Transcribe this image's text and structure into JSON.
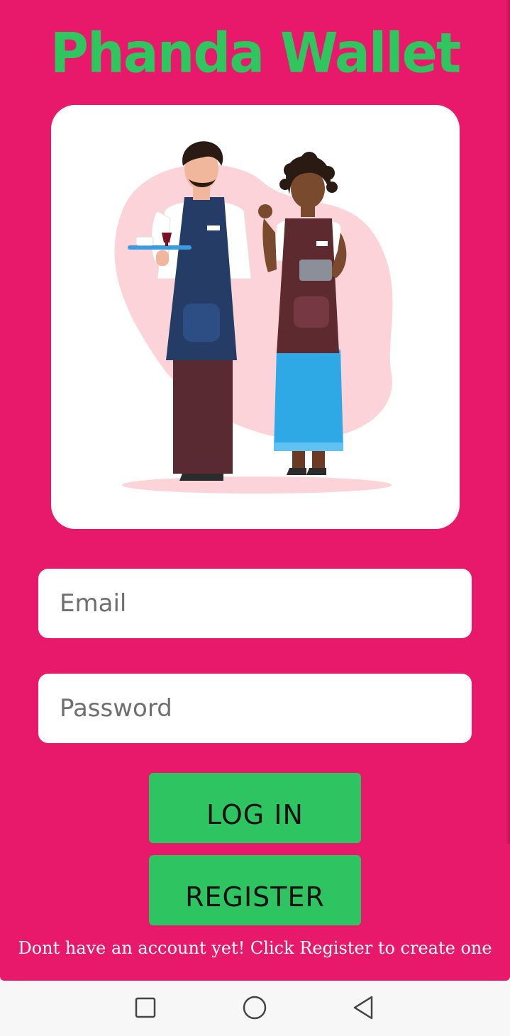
{
  "app": {
    "title": "Phanda Wallet",
    "colors": {
      "background": "#e8196b",
      "accent": "#2fc462",
      "field": "#ffffff",
      "text_on_accent": "#111111"
    }
  },
  "hero": {
    "illustration": "waiter-and-waitress-illustration"
  },
  "form": {
    "email": {
      "placeholder": "Email",
      "value": ""
    },
    "password": {
      "placeholder": "Password",
      "value": ""
    },
    "login_label": "LOG IN",
    "register_label": "REGISTER",
    "hint": "Dont have an account yet! Click Register to create one"
  },
  "navbar": {
    "recent_icon": "square-icon",
    "home_icon": "circle-icon",
    "back_icon": "triangle-back-icon"
  }
}
